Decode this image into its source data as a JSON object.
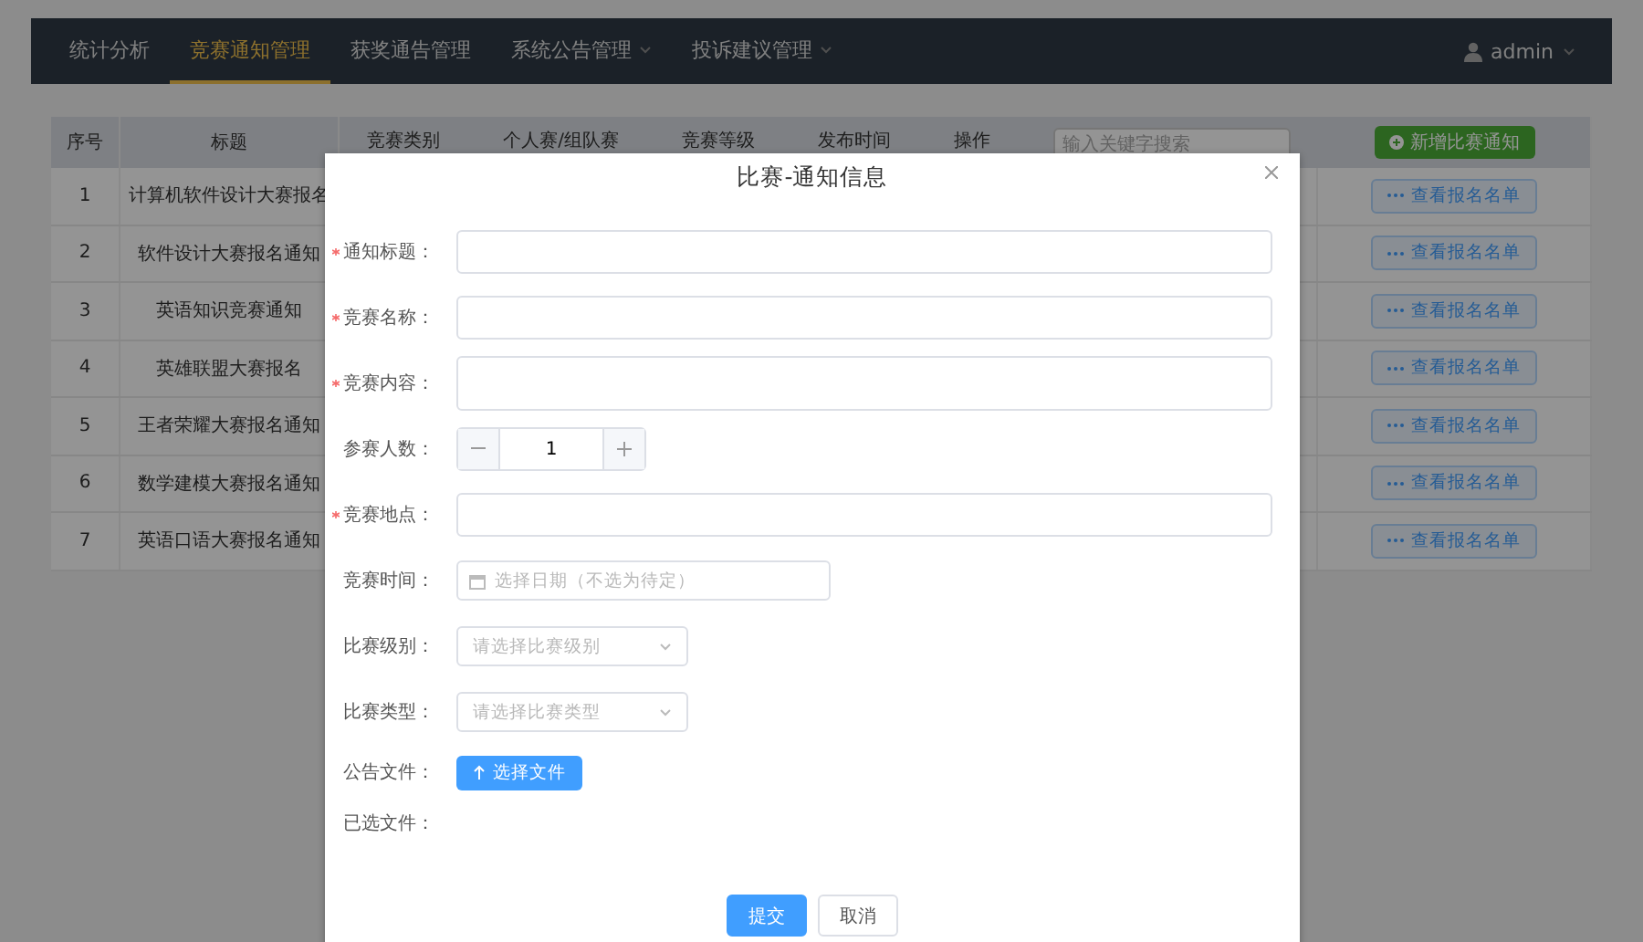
{
  "nav": {
    "items": [
      {
        "label": "统计分析",
        "selected": false,
        "dropdown": false
      },
      {
        "label": "竞赛通知管理",
        "selected": true,
        "dropdown": false
      },
      {
        "label": "获奖通告管理",
        "selected": false,
        "dropdown": false
      },
      {
        "label": "系统公告管理",
        "selected": false,
        "dropdown": true
      },
      {
        "label": "投诉建议管理",
        "selected": false,
        "dropdown": true
      }
    ],
    "user": "admin"
  },
  "table": {
    "columns": [
      "序号",
      "标题",
      "竞赛类别",
      "个人赛/组队赛",
      "竞赛等级",
      "发布时间",
      "操作"
    ],
    "search": {
      "placeholder": "输入关键字搜索"
    },
    "add_button": "新增比赛通知",
    "rows": [
      {
        "index": "1",
        "title": "计算机软件设计大赛报名",
        "action": "查看报名名单"
      },
      {
        "index": "2",
        "title": "软件设计大赛报名通知",
        "action": "查看报名名单"
      },
      {
        "index": "3",
        "title": "英语知识竞赛通知",
        "action": "查看报名名单"
      },
      {
        "index": "4",
        "title": "英雄联盟大赛报名",
        "action": "查看报名名单"
      },
      {
        "index": "5",
        "title": "王者荣耀大赛报名通知",
        "action": "查看报名名单"
      },
      {
        "index": "6",
        "title": "数学建模大赛报名通知",
        "action": "查看报名名单"
      },
      {
        "index": "7",
        "title": "英语口语大赛报名通知",
        "action": "查看报名名单"
      }
    ]
  },
  "dialog": {
    "title": "比赛-通知信息",
    "fields": [
      {
        "kind": "text",
        "label": "通知标题：",
        "required": true
      },
      {
        "kind": "text",
        "label": "竞赛名称：",
        "required": true
      },
      {
        "kind": "textarea",
        "label": "竞赛内容：",
        "required": true
      },
      {
        "kind": "number",
        "label": "参赛人数：",
        "required": false,
        "value": "1"
      },
      {
        "kind": "text",
        "label": "竞赛地点：",
        "required": true
      },
      {
        "kind": "date",
        "label": "竞赛时间：",
        "required": false,
        "placeholder": "选择日期（不选为待定）"
      },
      {
        "kind": "select",
        "label": "比赛级别：",
        "required": false,
        "placeholder": "请选择比赛级别"
      },
      {
        "kind": "select",
        "label": "比赛类型：",
        "required": false,
        "placeholder": "请选择比赛类型"
      },
      {
        "kind": "upload",
        "label": "公告文件：",
        "required": false,
        "button": "选择文件"
      },
      {
        "kind": "files",
        "label": "已选文件：",
        "required": false
      }
    ],
    "buttons": [
      {
        "label": "提交",
        "kind": "primary"
      },
      {
        "label": "取消",
        "kind": "default"
      }
    ]
  }
}
